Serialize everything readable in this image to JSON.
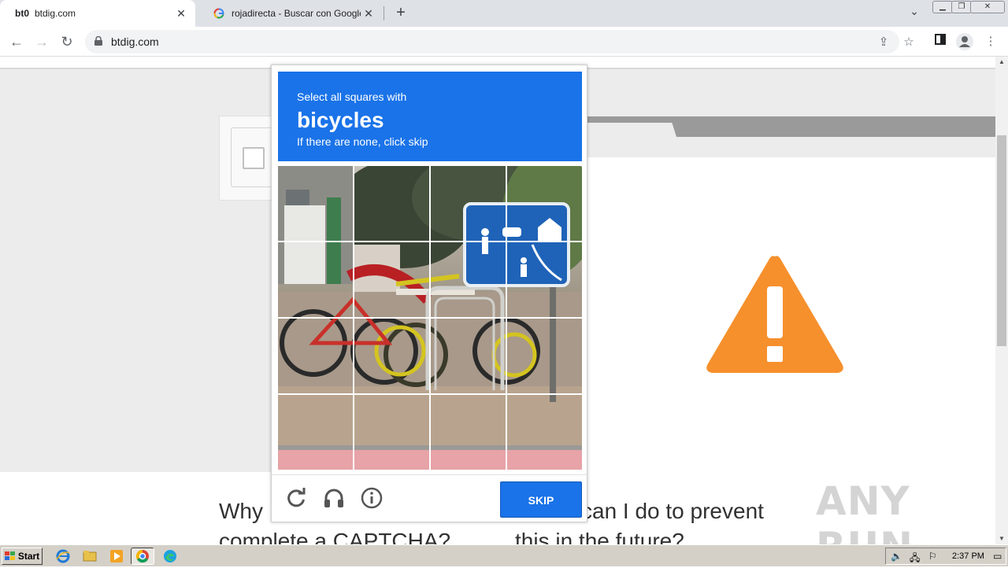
{
  "tabs": [
    {
      "favicon": "bt0",
      "title": "btdig.com",
      "active": true
    },
    {
      "favicon": "google-g-icon",
      "title": "rojadirecta - Buscar con Google",
      "active": false
    }
  ],
  "toolbar": {
    "url": "btdig.com"
  },
  "captcha": {
    "instruction_line1": "Select all squares with",
    "target": "bicycles",
    "instruction_line3": "If there are none, click skip",
    "skip_label": "SKIP",
    "grid_size": "4x4"
  },
  "page": {
    "question_left_l1": "Why",
    "question_left_l2": "complete a CAPTCHA?",
    "question_right_l1": "can I do to prevent",
    "question_right_l2": "this in the future?",
    "watermark": "ANY RUN",
    "warning_color": "#f6902c"
  },
  "taskbar": {
    "start_label": "Start",
    "clock": "2:37 PM"
  },
  "colors": {
    "accent": "#1a73e8"
  }
}
